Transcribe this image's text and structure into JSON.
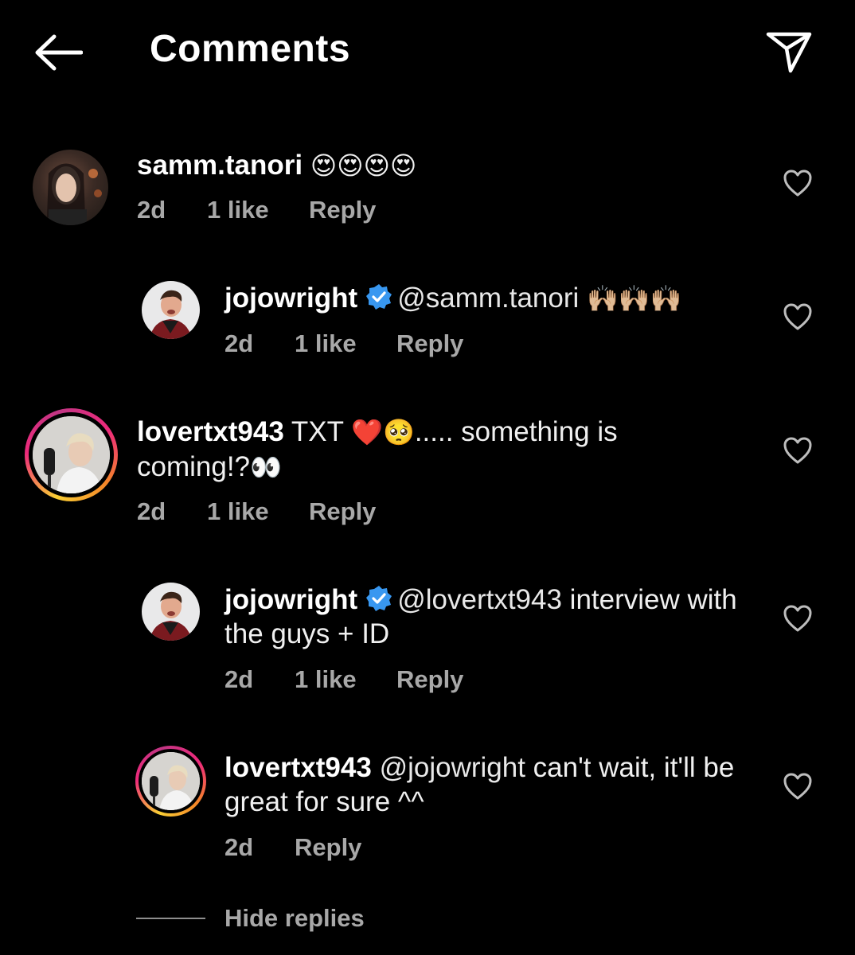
{
  "header": {
    "title": "Comments",
    "back_icon": "arrow-left-icon",
    "share_icon": "paper-plane-icon"
  },
  "comments": [
    {
      "username": "samm.tanori",
      "text": "",
      "emoji": "😍😍😍😍",
      "time": "2d",
      "likes": "1 like",
      "reply": "Reply"
    },
    {
      "username": "jojowright",
      "mention": "@samm.tanori",
      "text": "",
      "emoji": "🙌🏼🙌🏼🙌🏼",
      "time": "2d",
      "likes": "1 like",
      "reply": "Reply"
    },
    {
      "username": "lovertxt943",
      "text_before": " TXT ",
      "emoji_mid": "❤️🥺",
      "text_after": "..... something is coming!?",
      "emoji_end": "👀",
      "time": "2d",
      "likes": "1 like",
      "reply": "Reply"
    },
    {
      "username": "jojowright",
      "mention": "@lovertxt943",
      "text": " interview with the guys + ID",
      "time": "2d",
      "likes": "1 like",
      "reply": "Reply"
    },
    {
      "username": "lovertxt943",
      "mention": "@jojowright",
      "text": " can't wait, it'll be great for sure ^^",
      "time": "2d",
      "reply": "Reply"
    }
  ],
  "hide_replies": "Hide replies",
  "colors": {
    "background": "#000000",
    "text": "#f5f5f5",
    "meta": "#a8a8a8",
    "verified": "#3897f0"
  }
}
